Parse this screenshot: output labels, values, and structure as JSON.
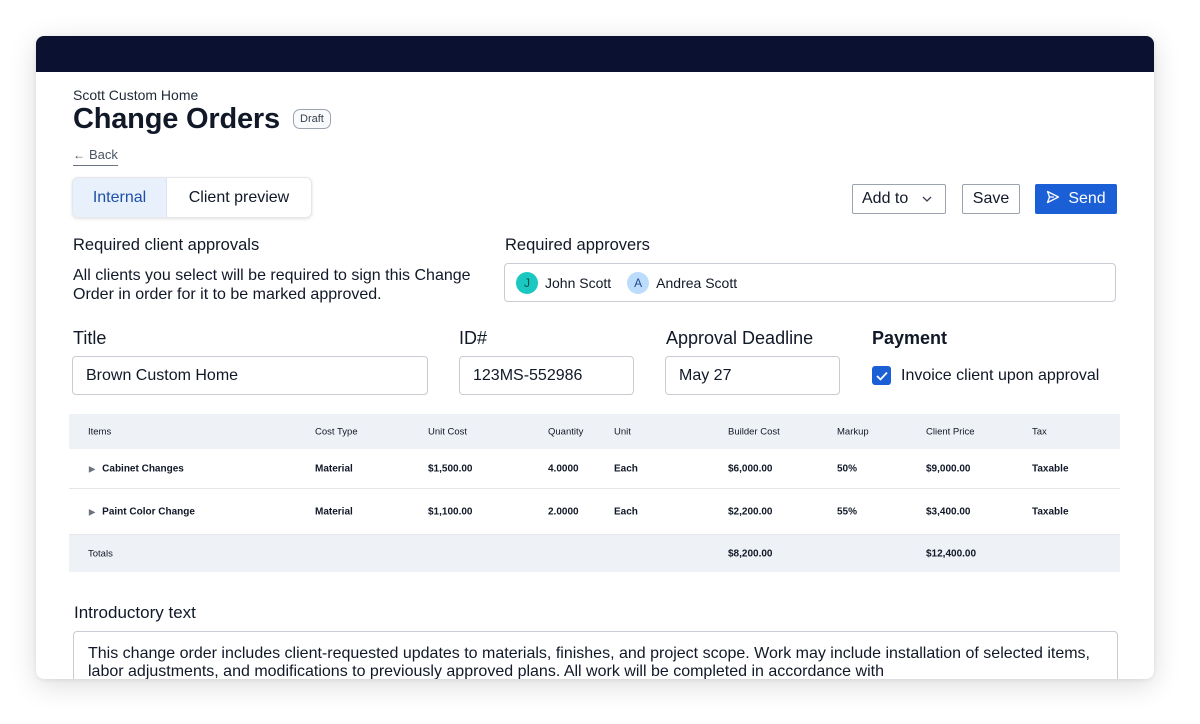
{
  "colors": {
    "topbar": "#0a1131",
    "primary": "#1a5fd6",
    "tab_active_bg": "#e8f0fb",
    "table_header_bg": "#eef1f5"
  },
  "header": {
    "company": "Scott Custom Home",
    "title": "Change Orders",
    "status_badge": "Draft",
    "back_label": "Back"
  },
  "tabs": [
    {
      "label": "Internal",
      "active": true
    },
    {
      "label": "Client preview",
      "active": false
    }
  ],
  "toolbar": {
    "add_to_label": "Add to",
    "save_label": "Save",
    "send_label": "Send"
  },
  "approvals": {
    "heading": "Required client approvals",
    "description": "All clients you select will be required to sign this Change Order in order for it to be marked approved."
  },
  "approvers": {
    "heading": "Required approvers",
    "people": [
      {
        "initial": "J",
        "name": "John Scott"
      },
      {
        "initial": "A",
        "name": "Andrea Scott"
      }
    ]
  },
  "form": {
    "title_label": "Title",
    "title_value": "Brown Custom Home",
    "id_label": "ID#",
    "id_value": "123MS-552986",
    "deadline_label": "Approval Deadline",
    "deadline_value": "May 27",
    "payment_label": "Payment",
    "invoice_label": "Invoice client upon approval",
    "invoice_checked": true
  },
  "table": {
    "headers": [
      "Items",
      "Cost Type",
      "Unit Cost",
      "Quantity",
      "Unit",
      "Builder Cost",
      "Markup",
      "Client Price",
      "Tax"
    ],
    "rows": [
      [
        "Cabinet Changes",
        "Material",
        "$1,500.00",
        "4.0000",
        "Each",
        "$6,000.00",
        "50%",
        "$9,000.00",
        "Taxable"
      ],
      [
        "Paint Color Change",
        "Material",
        "$1,100.00",
        "2.0000",
        "Each",
        "$2,200.00",
        "55%",
        "$3,400.00",
        "Taxable"
      ]
    ],
    "totals": {
      "label": "Totals",
      "builder_cost": "$8,200.00",
      "client_price": "$12,400.00"
    }
  },
  "intro": {
    "heading": "Introductory text",
    "text": "This change order includes client-requested updates to materials, finishes, and project scope. Work may include installation of selected items, labor adjustments, and modifications to previously approved plans. All work will be completed in accordance with"
  }
}
